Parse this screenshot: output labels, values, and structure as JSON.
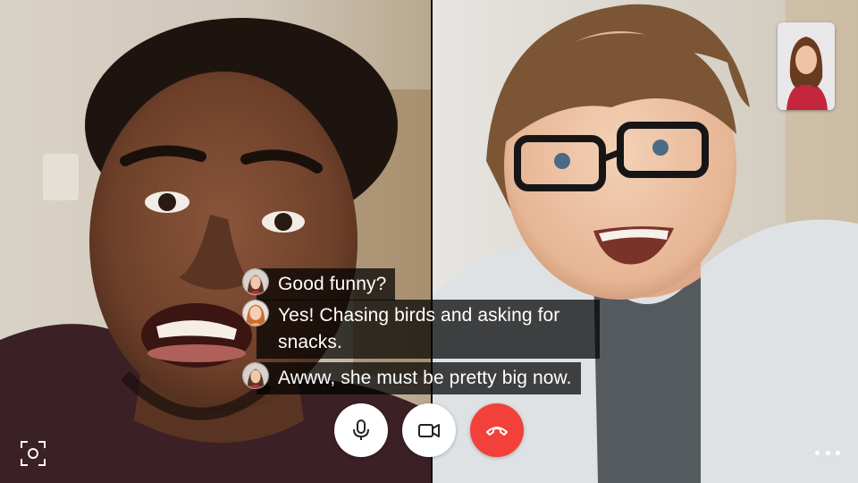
{
  "call": {
    "participants": [
      {
        "role": "left-video"
      },
      {
        "role": "right-video"
      }
    ],
    "self_view": {
      "role": "self-video"
    }
  },
  "captions": [
    {
      "text": "Good funny?",
      "avatar": "woman-avatar-icon"
    },
    {
      "text": "Yes! Chasing birds and asking for snacks.",
      "avatar": "woman-redhead-avatar-icon"
    },
    {
      "text": "Awww, she must be pretty big now.",
      "avatar": "woman-avatar-icon"
    }
  ],
  "controls": {
    "mic": {
      "icon": "microphone-icon"
    },
    "video": {
      "icon": "video-camera-icon"
    },
    "end_call": {
      "icon": "phone-hangup-icon",
      "color": "#f2413a"
    },
    "snapshot": {
      "icon": "camera-snapshot-icon"
    },
    "more": {
      "icon": "more-dots-icon"
    }
  },
  "colors": {
    "end_call": "#f2413a",
    "caption_bg": "rgba(0,0,0,0.72)",
    "icon": "#222222"
  }
}
